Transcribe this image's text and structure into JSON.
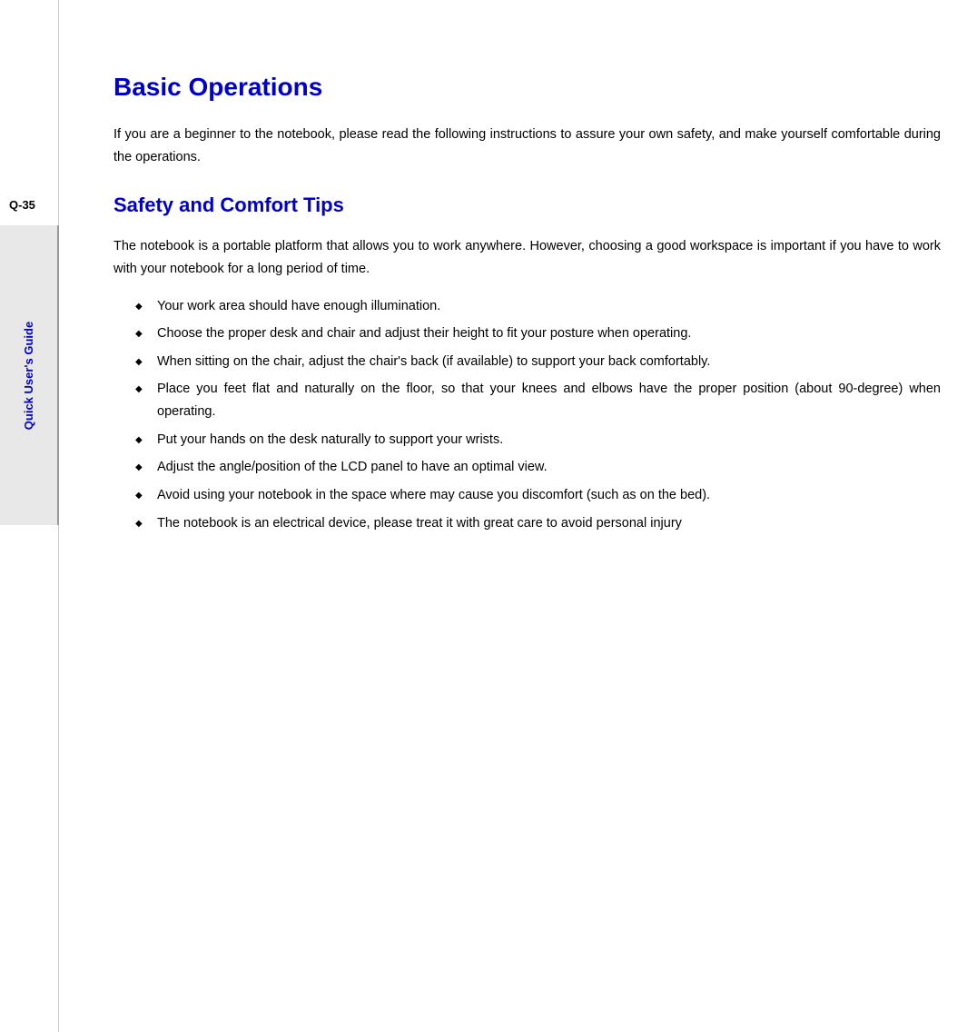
{
  "sidebar": {
    "page_number": "Q-35",
    "label": "Quick User's Guide"
  },
  "main": {
    "title": "Basic Operations",
    "intro": "If you are a beginner to the notebook, please read the following instructions to assure your own safety, and make yourself comfortable during the operations.",
    "section1": {
      "title": "Safety and Comfort Tips",
      "intro": "The notebook is a portable platform that allows you to work anywhere.   However, choosing a good workspace is important if you have to work with your notebook for a long period of time.",
      "bullets": [
        "Your work area should have enough illumination.",
        "Choose the proper desk and chair and adjust their height to fit your posture when operating.",
        "When sitting on the chair, adjust the chair's back (if available) to support your back comfortably.",
        "Place you feet flat and naturally on the floor, so that your knees and elbows have the proper position (about 90-degree) when operating.",
        "Put your hands on the desk naturally to support your wrists.",
        "Adjust the angle/position of the LCD panel to have an optimal view.",
        "Avoid using your notebook in the space where may cause you discomfort (such as on the bed).",
        "The notebook is an electrical device, please treat it with great care to avoid personal injury"
      ]
    }
  }
}
